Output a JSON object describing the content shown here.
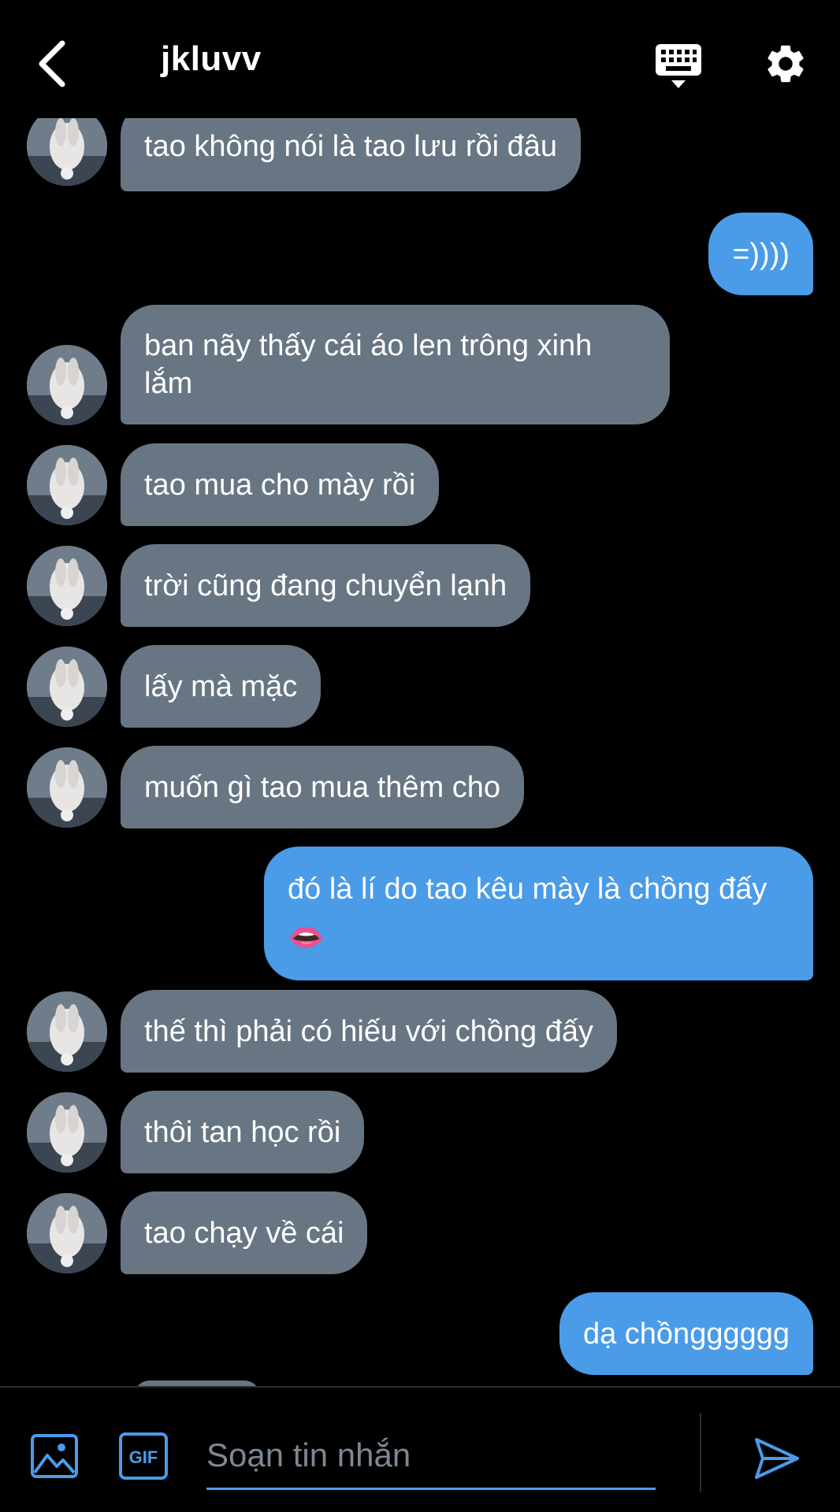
{
  "header": {
    "title": "jkluvv",
    "back_icon": "chevron-left-icon",
    "keyboard_icon": "keyboard-icon",
    "settings_icon": "gear-icon"
  },
  "messages": [
    {
      "side": "in",
      "text": "tao không nói là tao lưu rồi đâu"
    },
    {
      "side": "out",
      "text": "=))))"
    },
    {
      "side": "in",
      "text": "ban nãy thấy cái áo len trông xinh lắm"
    },
    {
      "side": "in",
      "text": "tao mua cho mày rồi"
    },
    {
      "side": "in",
      "text": "trời cũng đang chuyển lạnh"
    },
    {
      "side": "in",
      "text": "lấy mà mặc"
    },
    {
      "side": "in",
      "text": "muốn gì tao mua thêm cho"
    },
    {
      "side": "out",
      "text": "đó là lí do tao kêu mày là chồng đấy 👄"
    },
    {
      "side": "in",
      "text": "thế thì phải có hiếu với chồng đấy"
    },
    {
      "side": "in",
      "text": "thôi tan học rồi"
    },
    {
      "side": "in",
      "text": "tao chạy về cái"
    },
    {
      "side": "out",
      "text": "dạ chồngggggg"
    }
  ],
  "composer": {
    "placeholder": "Soạn tin nhắn",
    "gif_label": "GIF",
    "image_icon": "image-icon",
    "send_icon": "send-icon"
  },
  "colors": {
    "background": "#000000",
    "incoming_bubble": "#687683",
    "outgoing_bubble": "#4a9be8",
    "accent": "#4a9be8"
  }
}
